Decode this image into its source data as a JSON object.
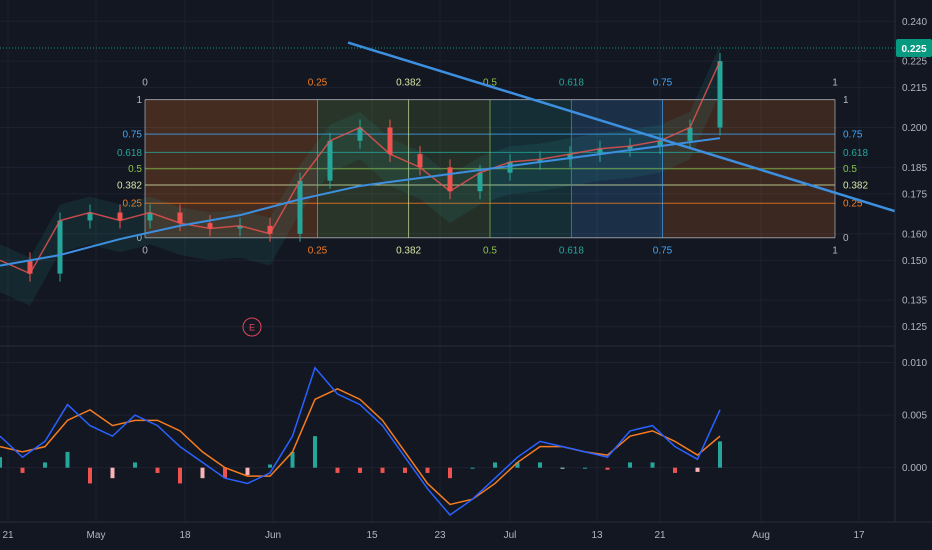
{
  "colors": {
    "background": "#131722",
    "grid": "#1e2230",
    "axis_text": "#b2b5be",
    "trendline": "#3d8fe0",
    "macd": "#2962ff",
    "signal": "#f57c20",
    "hist_up": "#26a69a",
    "hist_up_light": "#a8e0d4",
    "hist_down": "#ef5350",
    "hist_down_light": "#f7b3b5",
    "price_tag": "#089981",
    "fib_0": "#b2b5be",
    "fib_025": "#f57c20",
    "fib_0382": "#d4e6a5",
    "fib_05": "#8bc34a",
    "fib_0618": "#26a69a",
    "fib_075": "#42a5f5",
    "fib_1": "#b2b5be"
  },
  "price_axis": {
    "ticks": [
      "0.240",
      "0.225",
      "0.215",
      "0.200",
      "0.185",
      "0.175",
      "0.160",
      "0.150",
      "0.135",
      "0.125"
    ],
    "current_price": "0.225"
  },
  "macd_axis": {
    "ticks": [
      "0.010",
      "0.005",
      "0.000"
    ]
  },
  "time_axis": {
    "ticks": [
      "21",
      "May",
      "18",
      "Jun",
      "15",
      "23",
      "Jul",
      "13",
      "21",
      "Aug",
      "17"
    ]
  },
  "fib_levels": {
    "time_labels": [
      "0",
      "0.25",
      "0.382",
      "0.5",
      "0.618",
      "0.75",
      "1"
    ],
    "price_labels_left": [
      "1",
      "0.75",
      "0.618",
      "0.5",
      "0.382",
      "0.25",
      "0"
    ],
    "price_labels_right": [
      "1",
      "0.75",
      "0.618",
      "0.5",
      "0.382",
      "0.25",
      "0"
    ]
  },
  "earnings_marker": "E",
  "chart_data": [
    {
      "type": "candlestick",
      "title": "",
      "y_range": [
        0.12,
        0.245
      ],
      "trendline": {
        "from": [
          0.2325,
          0.232
        ],
        "to": [
          0.1685,
          0.1685
        ],
        "note": ""
      },
      "price_series": {
        "x": [
          0,
          4,
          8,
          12,
          16,
          20,
          24,
          28,
          32,
          36,
          40,
          44,
          48,
          52,
          56,
          60,
          64,
          68,
          72,
          76,
          80,
          84,
          88,
          92,
          96
        ],
        "values": [
          0.15,
          0.145,
          0.165,
          0.168,
          0.165,
          0.168,
          0.164,
          0.162,
          0.163,
          0.16,
          0.18,
          0.195,
          0.2,
          0.19,
          0.185,
          0.176,
          0.183,
          0.187,
          0.188,
          0.19,
          0.192,
          0.193,
          0.195,
          0.2,
          0.225
        ]
      },
      "moving_average": {
        "x": [
          0,
          8,
          16,
          24,
          32,
          40,
          48,
          56,
          64,
          72,
          80,
          88,
          96
        ],
        "values": [
          0.148,
          0.152,
          0.158,
          0.163,
          0.167,
          0.173,
          0.178,
          0.181,
          0.184,
          0.187,
          0.19,
          0.193,
          0.196
        ]
      }
    },
    {
      "type": "macd",
      "y_range": [
        -0.0045,
        0.011
      ],
      "x": [
        0,
        3,
        6,
        9,
        12,
        15,
        18,
        21,
        24,
        27,
        30,
        33,
        36,
        39,
        42,
        45,
        48,
        51,
        54,
        57,
        60,
        63,
        66,
        69,
        72,
        75,
        78,
        81,
        84,
        87,
        90,
        93,
        96
      ],
      "macd": [
        0.003,
        0.001,
        0.0025,
        0.006,
        0.004,
        0.003,
        0.005,
        0.004,
        0.002,
        0.0005,
        -0.001,
        -0.0015,
        -0.0005,
        0.003,
        0.0095,
        0.007,
        0.006,
        0.004,
        0.001,
        -0.002,
        -0.0045,
        -0.003,
        -0.001,
        0.001,
        0.0025,
        0.002,
        0.0015,
        0.001,
        0.0035,
        0.004,
        0.002,
        0.0008,
        0.0055
      ],
      "signal": [
        0.002,
        0.0015,
        0.002,
        0.0045,
        0.0055,
        0.004,
        0.0045,
        0.0045,
        0.0035,
        0.0015,
        0.0,
        -0.0008,
        -0.0008,
        0.0015,
        0.0065,
        0.0075,
        0.0065,
        0.0045,
        0.0015,
        -0.0015,
        -0.0035,
        -0.003,
        -0.0015,
        0.0005,
        0.002,
        0.002,
        0.0015,
        0.0012,
        0.003,
        0.0035,
        0.0025,
        0.0012,
        0.003
      ],
      "histogram": [
        0.001,
        -0.0005,
        0.0005,
        0.0015,
        -0.0015,
        -0.001,
        0.0005,
        -0.0005,
        -0.0015,
        -0.001,
        -0.001,
        -0.0007,
        0.0003,
        0.0015,
        0.003,
        -0.0005,
        -0.0005,
        -0.0005,
        -0.0005,
        -0.0005,
        -0.001,
        0.0,
        0.0005,
        0.0005,
        0.0005,
        0.0,
        0.0,
        -0.0002,
        0.0005,
        0.0005,
        -0.0005,
        -0.0004,
        0.0025
      ]
    }
  ]
}
